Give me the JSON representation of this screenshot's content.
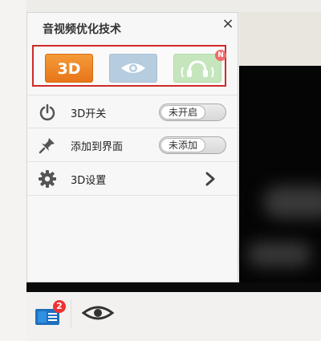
{
  "panel": {
    "title": "音视频优化技术",
    "close_glyph": "×",
    "tabs": [
      {
        "name": "3d",
        "label": "3D",
        "icon": "3d-icon",
        "color": "#ef8a2a"
      },
      {
        "name": "eye",
        "icon": "eye-icon",
        "color": "#b6ccdf"
      },
      {
        "name": "audio",
        "icon": "headphones-icon",
        "color": "#c5e6bd",
        "badge": "N"
      }
    ],
    "rows": [
      {
        "label": "3D开关",
        "icon": "power-icon",
        "toggle": "未开启"
      },
      {
        "label": "添加到界面",
        "icon": "pin-icon",
        "toggle": "未添加"
      },
      {
        "label": "3D设置",
        "icon": "gear-icon",
        "action": "chevron-right-icon"
      }
    ]
  },
  "taskbar": {
    "app_badge": "2",
    "icons": [
      "app-icon",
      "eye-icon"
    ]
  },
  "colors": {
    "accent_orange": "#ef8a2a",
    "highlight_red": "#cf2a2a",
    "badge_red": "#e33333"
  }
}
